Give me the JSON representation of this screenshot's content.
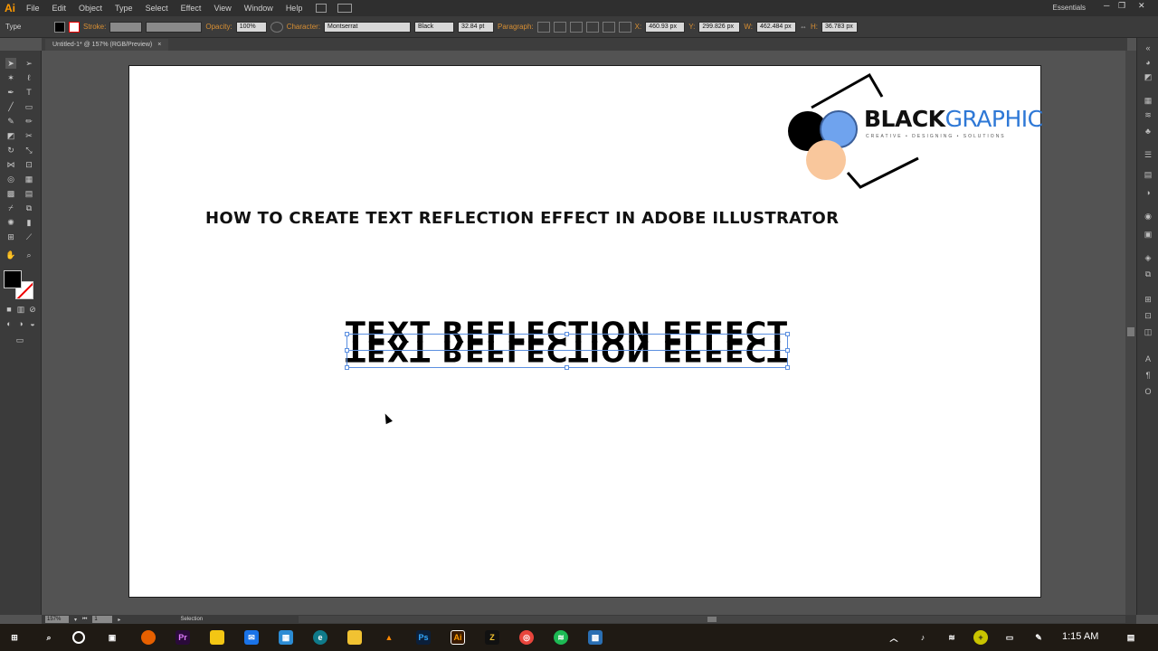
{
  "app": {
    "logo": "Ai"
  },
  "menu": [
    "File",
    "Edit",
    "Object",
    "Type",
    "Select",
    "Effect",
    "View",
    "Window",
    "Help"
  ],
  "workspace": "Essentials",
  "control_bar": {
    "tool": "Type",
    "stroke_label": "Stroke:",
    "opacity_label": "Opacity:",
    "opacity_value": "100%",
    "character_label": "Character:",
    "font": "Montserrat",
    "weight": "Black",
    "size": "32.84 pt",
    "paragraph_label": "Paragraph:",
    "x_label": "X:",
    "x_value": "460.93 px",
    "y_label": "Y:",
    "y_value": "299.826 px",
    "w_label": "W:",
    "w_value": "462.484 px",
    "h_label": "H:",
    "h_value": "36.783 px"
  },
  "document_tab": "Untitled-1* @ 157% (RGB/Preview)",
  "artboard": {
    "headline": "HOW TO CREATE TEXT REFLECTION EFFECT IN ADOBE ILLUSTRATOR",
    "effect_text": "TEXT REFLECTION EFFECT",
    "logo_black": "BLACK",
    "logo_blue": "GRAPHIC",
    "logo_tagline": "CREATIVE • DESIGNING • SOLUTIONS"
  },
  "status": {
    "zoom": "157%",
    "page": "1",
    "tool": "Selection"
  },
  "taskbar": {
    "time": "1:15 AM"
  },
  "colors": {
    "ui_dark": "#535353",
    "accent_orange": "#ff9a00",
    "logo_blue": "#2e78d6",
    "selection": "#5b8fe0"
  }
}
